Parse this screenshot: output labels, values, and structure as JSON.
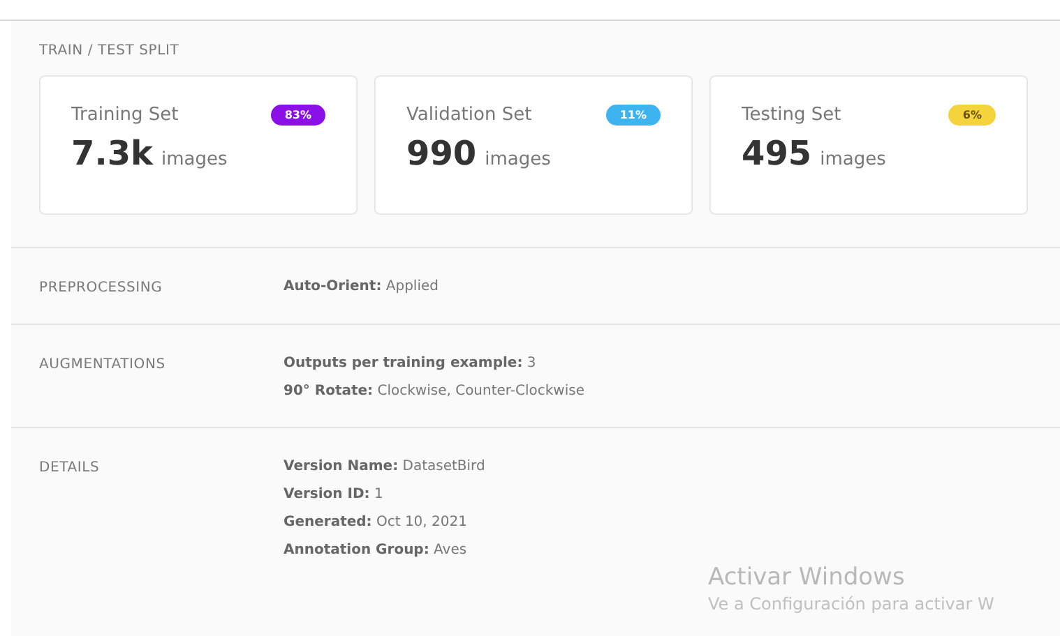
{
  "split": {
    "title": "TRAIN / TEST SPLIT",
    "cards": [
      {
        "label": "Training Set",
        "badge": "83%",
        "color": "#8b10e8",
        "count": "7.3k",
        "unit": "images"
      },
      {
        "label": "Validation Set",
        "badge": "11%",
        "color": "#3db4f0",
        "count": "990",
        "unit": "images"
      },
      {
        "label": "Testing Set",
        "badge": "6%",
        "color": "#f5d33c",
        "count": "495",
        "unit": "images"
      }
    ]
  },
  "sections": [
    {
      "label": "PREPROCESSING",
      "entries": [
        {
          "key": "Auto-Orient:",
          "value": "Applied"
        }
      ]
    },
    {
      "label": "AUGMENTATIONS",
      "entries": [
        {
          "key": "Outputs per training example:",
          "value": "3"
        },
        {
          "key": "90° Rotate:",
          "value": "Clockwise, Counter-Clockwise"
        }
      ]
    },
    {
      "label": "DETAILS",
      "entries": [
        {
          "key": "Version Name:",
          "value": "DatasetBird"
        },
        {
          "key": "Version ID:",
          "value": "1"
        },
        {
          "key": "Generated:",
          "value": "Oct 10, 2021"
        },
        {
          "key": "Annotation Group:",
          "value": "Aves"
        }
      ]
    }
  ],
  "activation_notice": {
    "title": "Activar Windows",
    "message": "Ve a Configuración para activar W"
  }
}
